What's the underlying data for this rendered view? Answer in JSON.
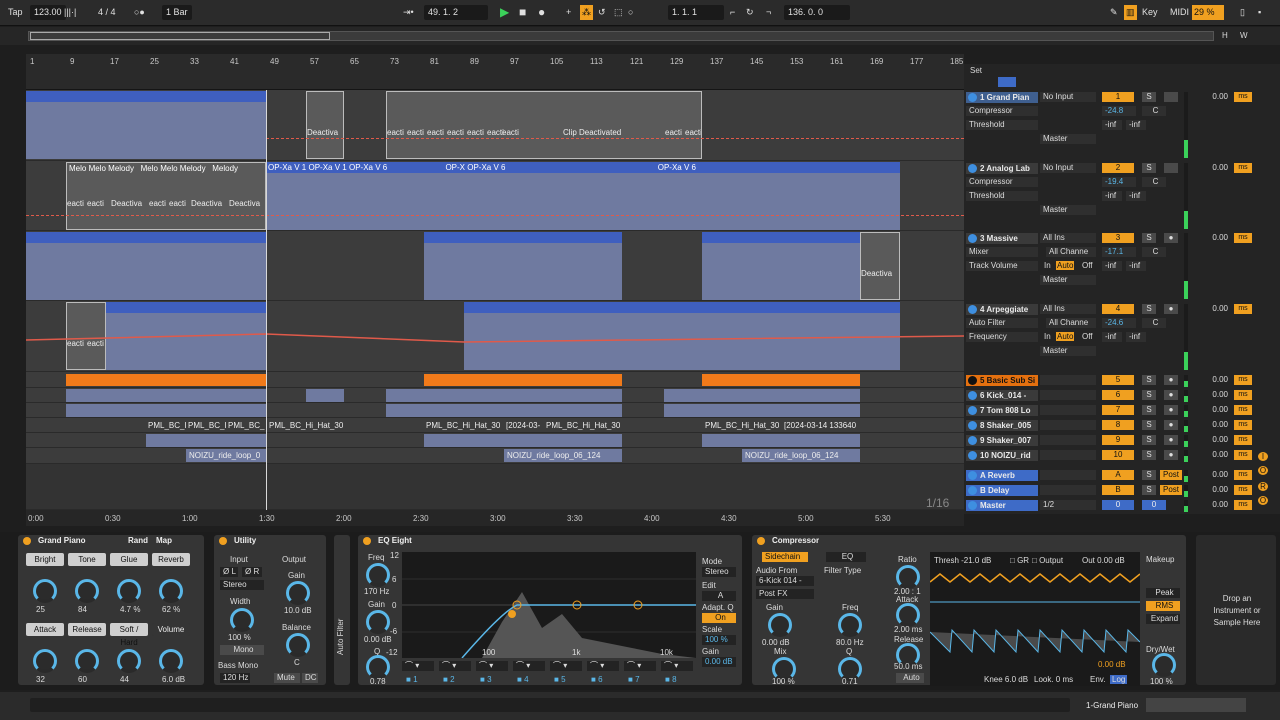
{
  "transport": {
    "tap": "Tap",
    "tempo": "123.00",
    "signature": "4 / 4",
    "quantize": "1 Bar",
    "position": "49.  1.  2",
    "loop_start": "1.  1.  1",
    "loop_length": "136.  0.  0",
    "key": "Key",
    "midi": "MIDI",
    "cpu": "29 %",
    "h": "H",
    "w": "W"
  },
  "ruler": {
    "bars": [
      "1",
      "9",
      "17",
      "25",
      "33",
      "41",
      "49",
      "57",
      "65",
      "73",
      "81",
      "89",
      "97",
      "105",
      "113",
      "121",
      "129",
      "137",
      "145",
      "153",
      "161",
      "169",
      "177",
      "185"
    ]
  },
  "timeline": {
    "times": [
      "0:00",
      "0:30",
      "1:00",
      "1:30",
      "2:00",
      "2:30",
      "3:00",
      "3:30",
      "4:00",
      "4:30",
      "5:00",
      "5:30"
    ],
    "zoom": "1/16"
  },
  "clips": {
    "deactivated": "Deactiva",
    "eacti": "eacti",
    "clip_deactivated": "Clip Deactivated",
    "melody": "Melody",
    "melo": "Melo",
    "opxa1": "OP-Xa V 1",
    "opxa6": "OP-Xa V 6",
    "opx": "OP-X",
    "pml": "PML_BC_Hi_Hat_30",
    "pml_short": "PML_BC_I",
    "pml_mid": "PML_BC_",
    "date1": "[2024-03-",
    "date2": "[2024-03-14 133640",
    "noizu1": "NOIZU_ride_loop_0",
    "noizu2": "NOIZU_ride_loop_06_124"
  },
  "mixer": {
    "set": "Set",
    "tracks": [
      {
        "name": "1 Grand Pian",
        "input": "No Input",
        "dev": "Compressor",
        "param": "Threshold",
        "num": "1",
        "vol": "-24.8",
        "pan": "C",
        "inf": "-inf",
        "out": "Master",
        "delay": "0.00",
        "unit": "ms"
      },
      {
        "name": "2 Analog Lab",
        "input": "No Input",
        "dev": "Compressor",
        "param": "Threshold",
        "num": "2",
        "vol": "-19.4",
        "pan": "C",
        "inf": "-inf",
        "out": "Master",
        "delay": "0.00",
        "unit": "ms"
      },
      {
        "name": "3 Massive",
        "input": "All Ins",
        "chan": "All Channe",
        "dev": "Mixer",
        "param": "Track Volume",
        "num": "3",
        "vol": "-17.1",
        "pan": "C",
        "inf": "-inf",
        "out": "Master",
        "delay": "0.00",
        "unit": "ms"
      },
      {
        "name": "4 Arpeggiate",
        "input": "All Ins",
        "chan": "All Channe",
        "dev": "Auto Filter",
        "param": "Frequency",
        "num": "4",
        "vol": "-24.6",
        "pan": "C",
        "inf": "-inf",
        "out": "Master",
        "delay": "0.00",
        "unit": "ms"
      }
    ],
    "small": [
      {
        "name": "5 Basic Sub Si",
        "num": "5",
        "delay": "0.00"
      },
      {
        "name": "6 Kick_014 -",
        "num": "6",
        "delay": "0.00"
      },
      {
        "name": "7 Tom 808 Lo",
        "num": "7",
        "delay": "0.00"
      },
      {
        "name": "8 Shaker_005",
        "num": "8",
        "delay": "0.00"
      },
      {
        "name": "9 Shaker_007",
        "num": "9",
        "delay": "0.00"
      },
      {
        "name": "10 NOIZU_rid",
        "num": "10",
        "delay": "0.00"
      },
      {
        "name": "A Reverb",
        "num": "A",
        "delay": "0.00",
        "post": "Post"
      },
      {
        "name": "B Delay",
        "num": "B",
        "delay": "0.00",
        "post": "Post"
      },
      {
        "name": "Master",
        "num": "0",
        "delay": "0.00",
        "cue": "1/2",
        "num2": "0"
      }
    ],
    "s": "S",
    "in": "In",
    "auto": "Auto",
    "off": "Off",
    "ms": "ms",
    "io": "I",
    "o": "O",
    "r": "R"
  },
  "devices": {
    "piano": {
      "title": "Grand Piano",
      "rand": "Rand",
      "map": "Map",
      "macros": [
        {
          "l": "Bright",
          "v": "25"
        },
        {
          "l": "Tone",
          "v": "84"
        },
        {
          "l": "Glue",
          "v": "4.7 %"
        },
        {
          "l": "Reverb",
          "v": "62 %"
        },
        {
          "l": "Attack",
          "v": "32"
        },
        {
          "l": "Release",
          "v": "60"
        },
        {
          "l": "Soft / Hard",
          "v": "44"
        },
        {
          "l": "Volume",
          "v": "6.0 dB"
        }
      ]
    },
    "utility": {
      "title": "Utility",
      "input": "Input",
      "output": "Output",
      "l": "Ø L",
      "r": "Ø R",
      "stereo": "Stereo",
      "gain": "Gain",
      "gain_v": "10.0 dB",
      "width": "Width",
      "width_v": "100 %",
      "mono": "Mono",
      "balance": "Balance",
      "balance_v": "C",
      "bassmono": "Bass Mono",
      "bass_hz": "120 Hz",
      "mute": "Mute",
      "dc": "DC"
    },
    "autofilter": {
      "label": "Auto Filter"
    },
    "eq": {
      "title": "EQ Eight",
      "freq": "Freq",
      "freq_v": "170 Hz",
      "gain": "Gain",
      "gain_v": "0.00 dB",
      "q": "Q",
      "q_v": "0.78",
      "db": [
        "12",
        "6",
        "0",
        "-6",
        "-12"
      ],
      "hz": [
        "100",
        "1k",
        "10k"
      ],
      "mode": "Mode",
      "stereo": "Stereo",
      "edit": "Edit",
      "a": "A",
      "adapt": "Adapt. Q",
      "on": "On",
      "scale": "Scale",
      "scale_v": "100 %",
      "gain2": "Gain",
      "gain2_v": "0.00 dB",
      "bands": [
        "1",
        "2",
        "3",
        "4",
        "5",
        "6",
        "7",
        "8"
      ]
    },
    "comp": {
      "title": "Compressor",
      "sidechain": "Sidechain",
      "eq": "EQ",
      "audio_from": "Audio From",
      "src": "6-Kick 014 -",
      "postfx": "Post FX",
      "filter_type": "Filter Type",
      "gain": "Gain",
      "gain_v": "0.00 dB",
      "freq": "Freq",
      "freq_v": "80.0 Hz",
      "mix": "Mix",
      "mix_v": "100 %",
      "q": "Q",
      "q_v": "0.71",
      "ratio": "Ratio",
      "ratio_v": "2.00 : 1",
      "attack": "Attack",
      "attack_v": "2.00 ms",
      "release": "Release",
      "release_v": "50.0 ms",
      "auto": "Auto",
      "thresh": "Thresh -21.0 dB",
      "gr": "GR",
      "outputl": "Output",
      "out": "Out 0.00 dB",
      "knee": "Knee 6.0 dB",
      "look": "Look. 0 ms",
      "env": "Env.",
      "log": "Log",
      "makeup": "Makeup",
      "peak": "Peak",
      "rms": "RMS",
      "expand": "Expand",
      "drywet": "Dry/Wet",
      "drywet_v": "100 %",
      "readout": "0.00 dB"
    },
    "drop": "Drop an Instrument or Sample Here"
  },
  "status": {
    "track": "1-Grand Piano"
  }
}
